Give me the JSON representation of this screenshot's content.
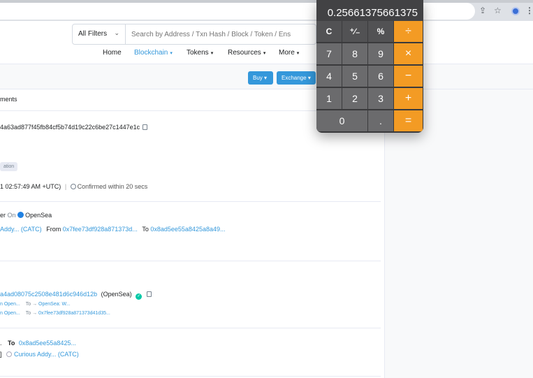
{
  "search": {
    "filter_label": "All Filters",
    "placeholder": "Search by Address / Txn Hash / Block / Token / Ens"
  },
  "nav": {
    "home": "Home",
    "blockchain": "Blockchain",
    "tokens": "Tokens",
    "resources": "Resources",
    "more": "More"
  },
  "actions": {
    "buy": "Buy",
    "exchange": "Exchange"
  },
  "content": {
    "tab_label": "ments",
    "tx_hash": "4a63ad877f45fb84cf5b74d19c22c6be27c1447e1c",
    "badge": "ation",
    "timestamp": "1 02:57:49 AM +UTC)",
    "separator": "|",
    "confirmed": "Confirmed within 20 secs",
    "action_prefix": "er",
    "action_on": "On",
    "marketplace": "OpenSea",
    "token_name": "Addy... (CATC)",
    "from_label": "From",
    "from_address": "0x7fee73df928a871373d...",
    "to_label": "To",
    "to_address": "0x8ad5ee55a8425a8a49...",
    "interacted_address": "a4ad08075c2508e481d6c946d12b",
    "interacted_label": "(OpenSea)",
    "check_glyph": "✓",
    "transfer1_from": "n Open...",
    "transfer1_to_label": "To →",
    "transfer1_to": "OpenSea: W...",
    "transfer2_from": "n Open...",
    "transfer2_to_label": "To →",
    "transfer2_to": "0x7fee73df928a871373d41d35...",
    "tokens_prefix": ".",
    "tokens_to_label": "To",
    "tokens_to": "0x8ad5ee55a8425...",
    "tokens_bracket": "]",
    "tokens_name": "Curious Addy... (CATC)"
  },
  "calculator": {
    "display": "0.25661375661375",
    "keys": {
      "clear": "C",
      "sign": "⁺∕₋",
      "percent": "%",
      "divide": "÷",
      "seven": "7",
      "eight": "8",
      "nine": "9",
      "multiply": "×",
      "four": "4",
      "five": "5",
      "six": "6",
      "minus": "−",
      "one": "1",
      "two": "2",
      "three": "3",
      "plus": "+",
      "zero": "0",
      "decimal": ".",
      "equals": "="
    }
  },
  "icons": {
    "share": "⇪",
    "star": "☆",
    "menu": "⋮"
  },
  "colors": {
    "accent": "#3498db",
    "calc_operator": "#f39b24",
    "success": "#00c9a7"
  }
}
